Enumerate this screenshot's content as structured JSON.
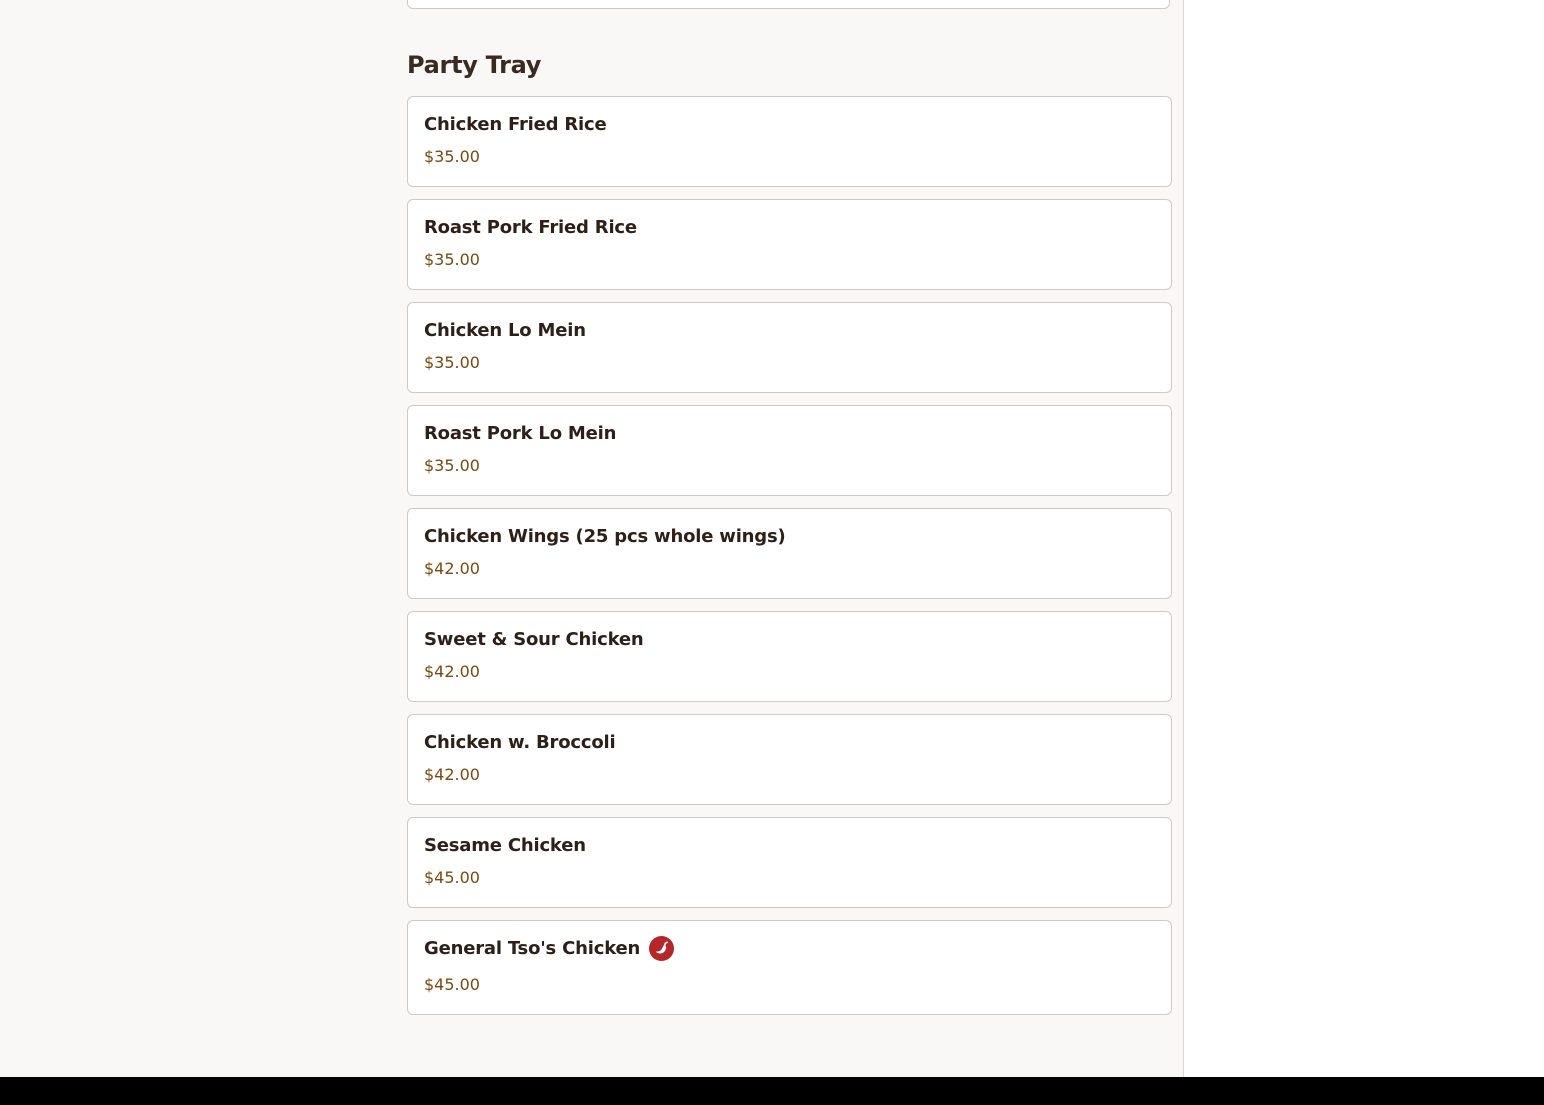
{
  "section": {
    "title": "Party Tray"
  },
  "items": [
    {
      "name": "Chicken Fried Rice",
      "price": "$35.00",
      "spicy": false
    },
    {
      "name": "Roast Pork Fried Rice",
      "price": "$35.00",
      "spicy": false
    },
    {
      "name": "Chicken Lo Mein",
      "price": "$35.00",
      "spicy": false
    },
    {
      "name": "Roast Pork Lo Mein",
      "price": "$35.00",
      "spicy": false
    },
    {
      "name": "Chicken Wings (25 pcs whole wings)",
      "price": "$42.00",
      "spicy": false
    },
    {
      "name": "Sweet & Sour Chicken",
      "price": "$42.00",
      "spicy": false
    },
    {
      "name": "Chicken w. Broccoli",
      "price": "$42.00",
      "spicy": false
    },
    {
      "name": "Sesame Chicken",
      "price": "$45.00",
      "spicy": false
    },
    {
      "name": "General Tso's Chicken",
      "price": "$45.00",
      "spicy": true,
      "icon": "spicy-pepper-icon"
    }
  ],
  "colors": {
    "title": "#3a2a22",
    "item_name": "#2e1f19",
    "price": "#7a4a10",
    "spicy_badge": "#b3272b",
    "footer": "#000000"
  }
}
